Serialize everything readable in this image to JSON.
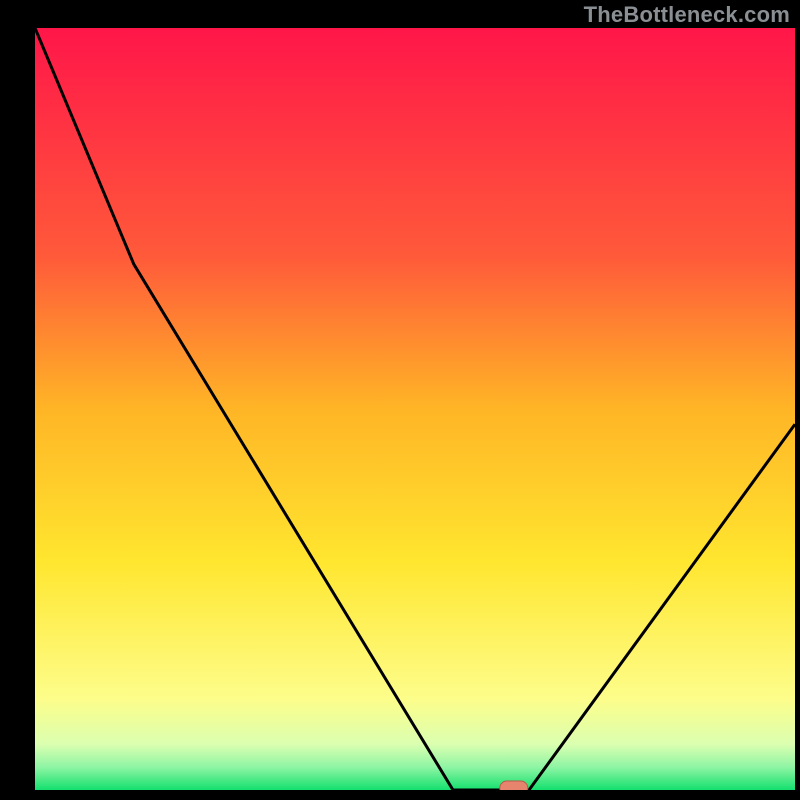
{
  "watermark": "TheBottleneck.com",
  "chart_data": {
    "type": "line",
    "title": "",
    "xlabel": "",
    "ylabel": "",
    "xlim": [
      0,
      100
    ],
    "ylim": [
      0,
      100
    ],
    "series": [
      {
        "name": "curve",
        "x": [
          0,
          13,
          55,
          60,
          65,
          100
        ],
        "values": [
          100,
          69,
          0,
          0,
          0,
          48
        ]
      }
    ],
    "marker": {
      "x": 63,
      "y": 0
    },
    "gradient_stops": [
      {
        "offset": 0.0,
        "color": "#ff1649"
      },
      {
        "offset": 0.3,
        "color": "#ff5a3a"
      },
      {
        "offset": 0.5,
        "color": "#ffb526"
      },
      {
        "offset": 0.7,
        "color": "#ffe62f"
      },
      {
        "offset": 0.88,
        "color": "#fdfd8a"
      },
      {
        "offset": 0.94,
        "color": "#dbffb0"
      },
      {
        "offset": 0.97,
        "color": "#8ef5a4"
      },
      {
        "offset": 1.0,
        "color": "#14e06e"
      }
    ],
    "marker_color": "#e6846e",
    "marker_stroke": "#b85a4a",
    "curve_color": "#000000"
  }
}
